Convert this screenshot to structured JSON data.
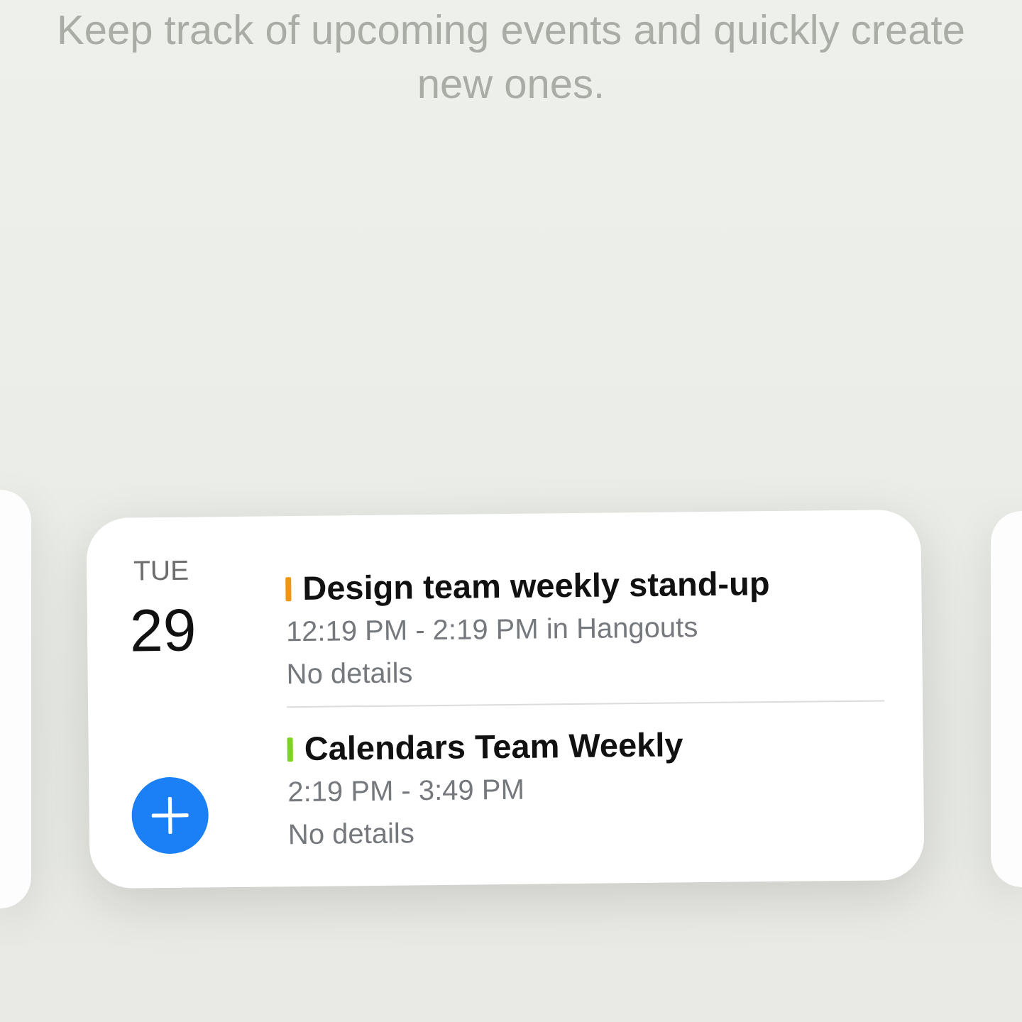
{
  "description": "Keep track of upcoming events and quickly create new ones.",
  "widget": {
    "weekday": "TUE",
    "day": "29",
    "events": [
      {
        "title": "Design team weekly stand-up",
        "color": "#f0960f",
        "time": "12:19 PM - 2:19 PM in Hangouts",
        "details": "No details"
      },
      {
        "title": "Calendars Team Weekly",
        "color": "#7ed321",
        "time": "2:19 PM - 3:49 PM",
        "details": "No details"
      }
    ]
  }
}
